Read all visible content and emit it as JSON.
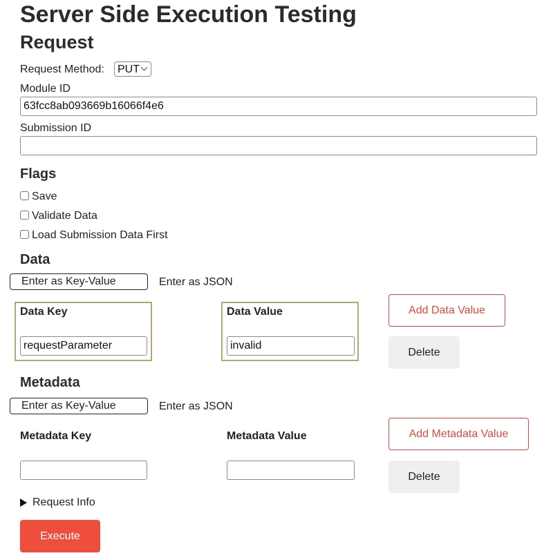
{
  "page": {
    "title": "Server Side Execution Testing",
    "request_heading": "Request"
  },
  "request": {
    "method_label": "Request Method:",
    "method_value": "PUT",
    "module_id_label": "Module ID",
    "module_id_value": "63fcc8ab093669b16066f4e6",
    "submission_id_label": "Submission ID",
    "submission_id_value": ""
  },
  "flags": {
    "heading": "Flags",
    "items": [
      {
        "label": "Save",
        "checked": false
      },
      {
        "label": "Validate Data",
        "checked": false
      },
      {
        "label": "Load Submission Data First",
        "checked": false
      }
    ]
  },
  "data": {
    "heading": "Data",
    "tabs": [
      "Enter as Key-Value",
      "Enter as JSON"
    ],
    "key_label": "Data Key",
    "value_label": "Data Value",
    "key_value": "requestParameter",
    "value_value": "invalid",
    "add_label": "Add Data Value",
    "delete_label": "Delete"
  },
  "metadata": {
    "heading": "Metadata",
    "tabs": [
      "Enter as Key-Value",
      "Enter as JSON"
    ],
    "key_label": "Metadata Key",
    "value_label": "Metadata Value",
    "key_value": "",
    "value_value": "",
    "add_label": "Add Metadata Value",
    "delete_label": "Delete"
  },
  "request_info": {
    "label": "Request Info"
  },
  "actions": {
    "execute_label": "Execute"
  },
  "colors": {
    "accent": "#ef4e3d",
    "outline_red": "#e04a3c",
    "kv_border": "#b8a76b",
    "grey_button": "#efefef"
  }
}
